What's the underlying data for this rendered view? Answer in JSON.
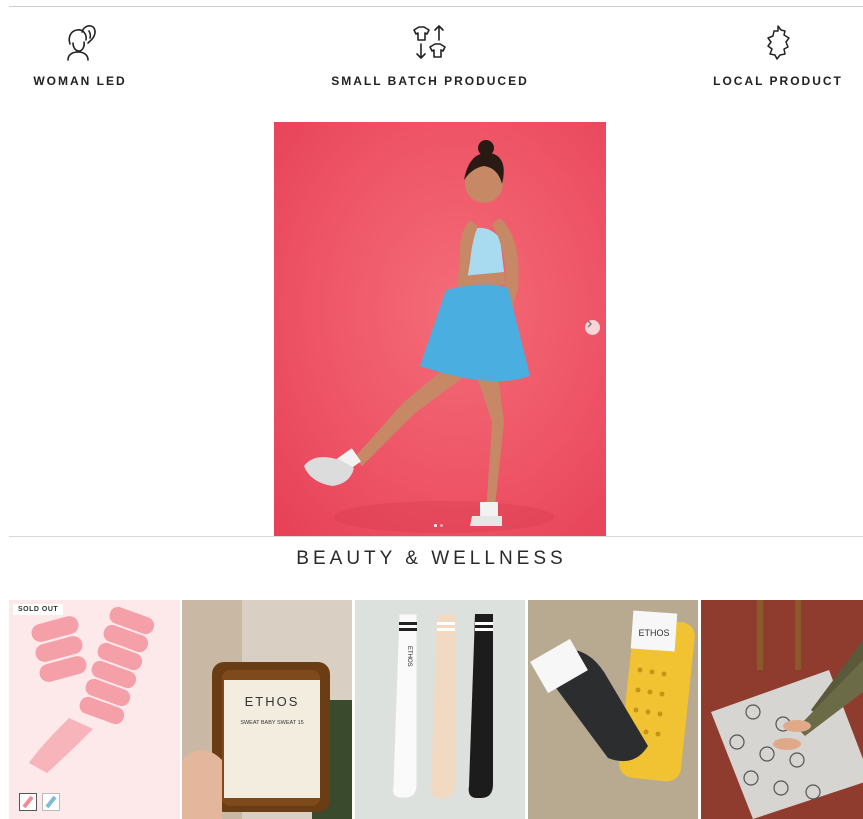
{
  "features": [
    {
      "label": "WOMAN LED",
      "icon": "woman-profile-icon"
    },
    {
      "label": "SMALL BATCH PRODUCED",
      "icon": "shirts-exchange-icon"
    },
    {
      "label": "LOCAL PRODUCT",
      "icon": "country-map-icon"
    }
  ],
  "hero": {
    "image": "woman in blue sports top and skirt kicking, pink background",
    "next_icon": "chevron-right-icon",
    "slide_count": 2,
    "active_slide": 1
  },
  "section": {
    "title": "BEAUTY & WELLNESS"
  },
  "products": [
    {
      "image": "pink wrist weights",
      "badge": "SOLD OUT",
      "swatches": [
        "pink",
        "blue"
      ]
    },
    {
      "image": "ETHOS amber candle",
      "candle_brand": "ETHOS",
      "candle_name": "SWEAT BABY SWEAT 15"
    },
    {
      "image": "three crew socks white beige black",
      "sock_brand": "ETHOS"
    },
    {
      "image": "black grip socks with yellow packaging",
      "pack_brand": "ETHOS"
    },
    {
      "image": "feet on smiley face yoga mat"
    }
  ],
  "colors": {
    "hero_bg": "#ee5566",
    "skirt": "#4aaee0",
    "top": "#a8daf0",
    "accent_pink": "#f28b96"
  }
}
